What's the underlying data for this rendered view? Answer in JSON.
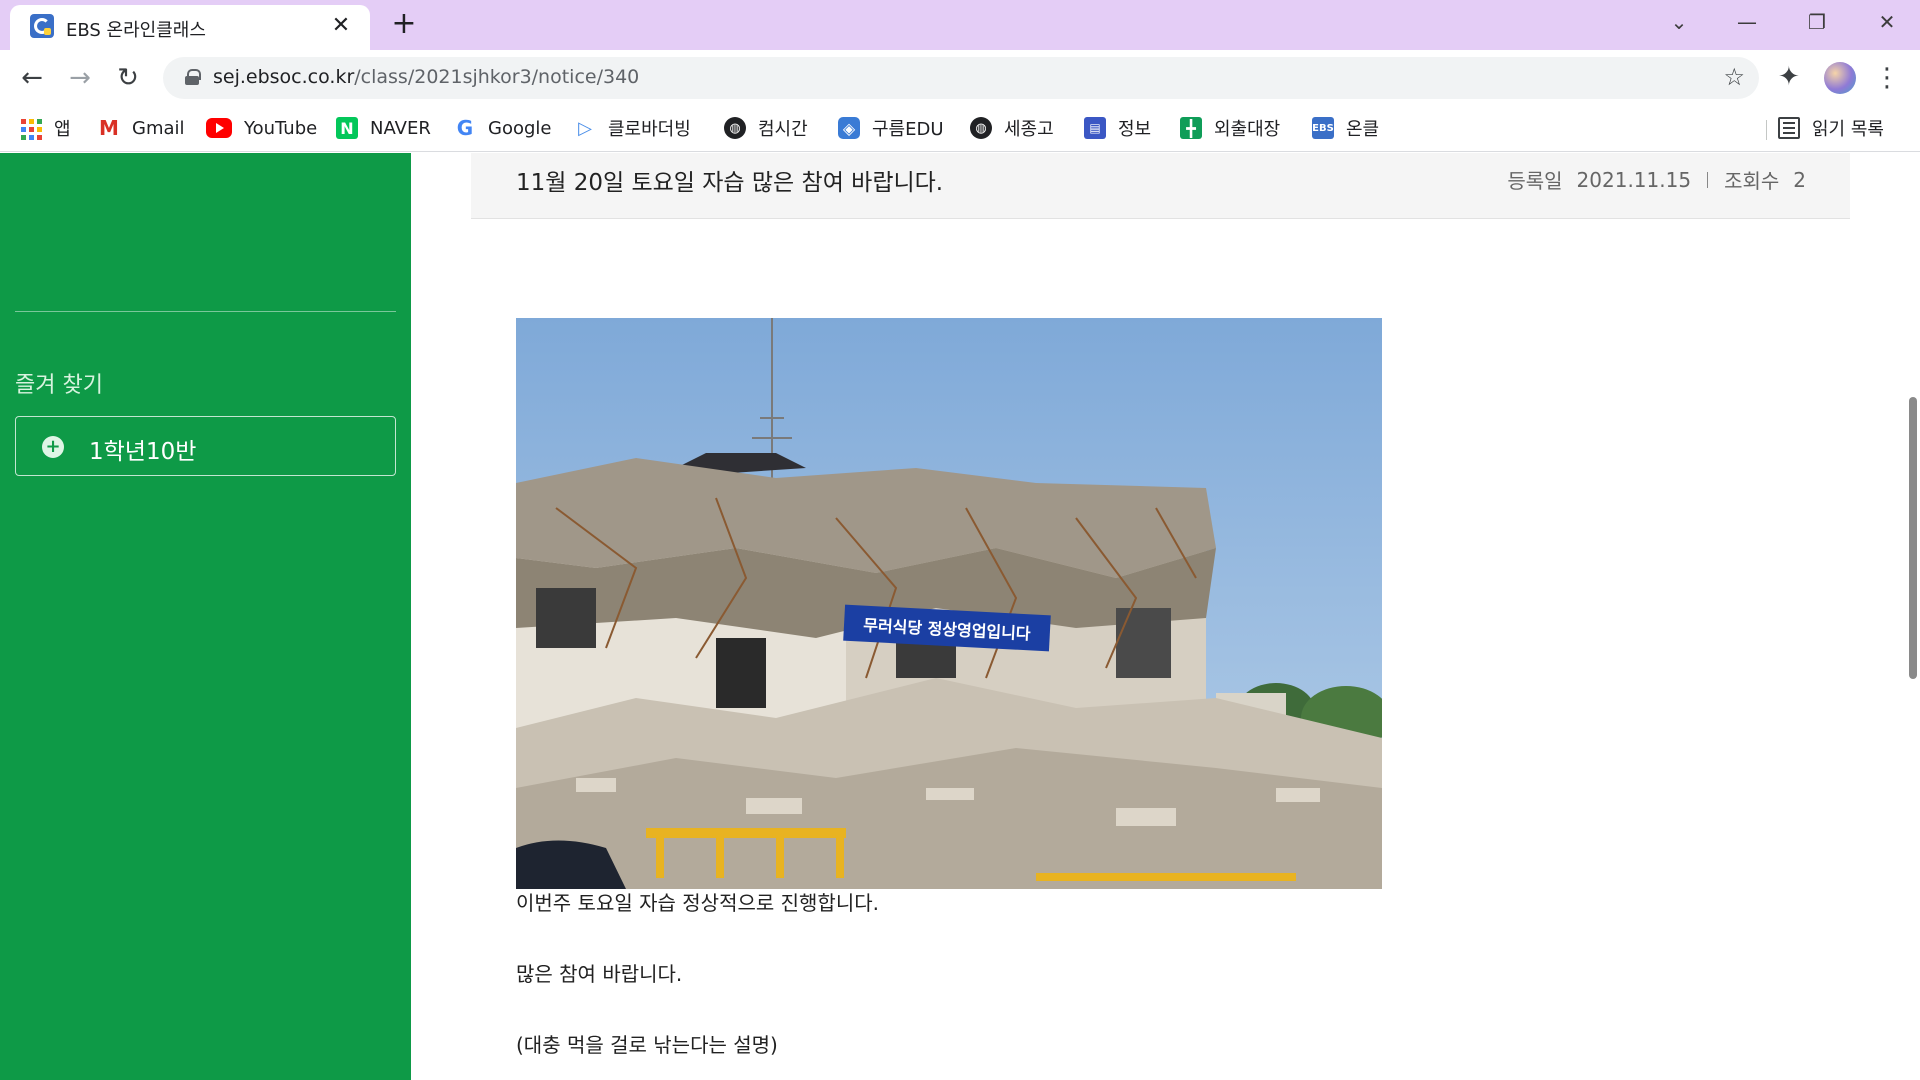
{
  "browser": {
    "tab_title": "EBS 온라인클래스",
    "tab_close": "✕",
    "new_tab": "+",
    "url_host": "sej.ebsoc.co.kr",
    "url_path": "/class/2021sjhkor3/notice/340",
    "window_controls": {
      "search": "⌄",
      "minimize": "—",
      "maximize": "❐",
      "close": "✕"
    }
  },
  "bookmarks": [
    {
      "label": "앱",
      "icon": "apps-grid-icon"
    },
    {
      "label": "Gmail",
      "icon": "gmail-icon"
    },
    {
      "label": "YouTube",
      "icon": "youtube-icon"
    },
    {
      "label": "NAVER",
      "icon": "naver-icon"
    },
    {
      "label": "Google",
      "icon": "google-icon"
    },
    {
      "label": "클로바더빙",
      "icon": "play-icon"
    },
    {
      "label": "컴시간",
      "icon": "globe-icon"
    },
    {
      "label": "구름EDU",
      "icon": "goorm-icon"
    },
    {
      "label": "세종고",
      "icon": "globe-icon"
    },
    {
      "label": "정보",
      "icon": "form-icon"
    },
    {
      "label": "외출대장",
      "icon": "sheet-icon"
    },
    {
      "label": "온클",
      "icon": "ebs-icon"
    }
  ],
  "bookmark_glyphs": {
    "naver": "N",
    "google": "G",
    "gmail": "M",
    "play": "▷",
    "globe": "◍",
    "goorm": "◈",
    "form": "▤",
    "sheet": "╋",
    "ebs": "EBS"
  },
  "reading_list": "읽기 목록",
  "sidebar": {
    "favorites_title": "즐겨 찾기",
    "favorite_items": [
      {
        "label": "1학년10반",
        "icon": "plus-circle-icon",
        "glyph": "+"
      }
    ]
  },
  "post": {
    "title": "11월 20일 토요일 자습 많은 참여 바랍니다.",
    "date_label": "등록일",
    "date": "2021.11.15",
    "views_label": "조회수",
    "views": "2",
    "image_banner": "무러식당 정상영업입니다",
    "body_lines": [
      "이번주 토요일 자습 정상적으로 진행합니다.",
      "많은 참여 바랍니다.",
      "(대충 먹을 걸로 낚는다는 설명)"
    ]
  },
  "colors": {
    "tab_strip": "#e4cdf6",
    "sidebar": "#0e9a47",
    "header_bg": "#f5f5f5",
    "sky": "#7fa9d8"
  }
}
